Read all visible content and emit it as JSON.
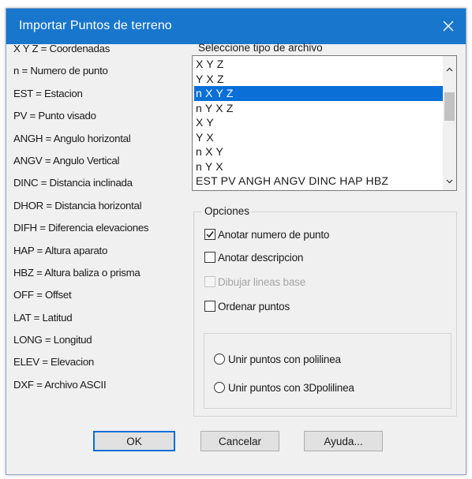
{
  "window": {
    "title": "Importar Puntos de terreno",
    "close_icon": "close-icon"
  },
  "legend": [
    "X Y Z = Coordenadas",
    "n = Numero de punto",
    "EST = Estacion",
    "PV = Punto visado",
    "ANGH = Angulo horizontal",
    "ANGV = Angulo Vertical",
    "DINC = Distancia inclinada",
    "DHOR = Distancia horizontal",
    "DIFH = Diferencia elevaciones",
    "HAP = Altura aparato",
    "HBZ = Altura baliza o prisma",
    "OFF = Offset",
    "LAT = Latitud",
    "LONG = Longitud",
    "ELEV = Elevacion",
    "DXF = Archivo ASCII"
  ],
  "file_type": {
    "label": "Seleccione tipo de archivo",
    "items": [
      "X Y Z",
      "Y X Z",
      "n X Y Z",
      "n Y X Z",
      "X Y",
      "Y X",
      "n X Y",
      "n Y X",
      "EST PV ANGH ANGV DINC HAP HBZ"
    ],
    "selected": "n X Y Z"
  },
  "options": {
    "label": "Opciones",
    "anotar_numero": "Anotar numero de punto",
    "anotar_descripcion": "Anotar descripcion",
    "dibujar_lineas": "Dibujar lineas base",
    "ordenar_puntos": "Ordenar puntos",
    "unir_polilinea": "Unir puntos con polilinea",
    "unir_3dpolilinea": "Unir puntos con 3Dpolilinea",
    "checked": [
      "Anotar numero de punto"
    ],
    "disabled": [
      "Dibujar lineas base"
    ]
  },
  "buttons": {
    "ok": "OK",
    "cancel": "Cancelar",
    "help": "Ayuda..."
  },
  "colors": {
    "titlebar": "#1976cd",
    "selection": "#0a6fd6",
    "dialog_bg": "#f0f0f0"
  }
}
